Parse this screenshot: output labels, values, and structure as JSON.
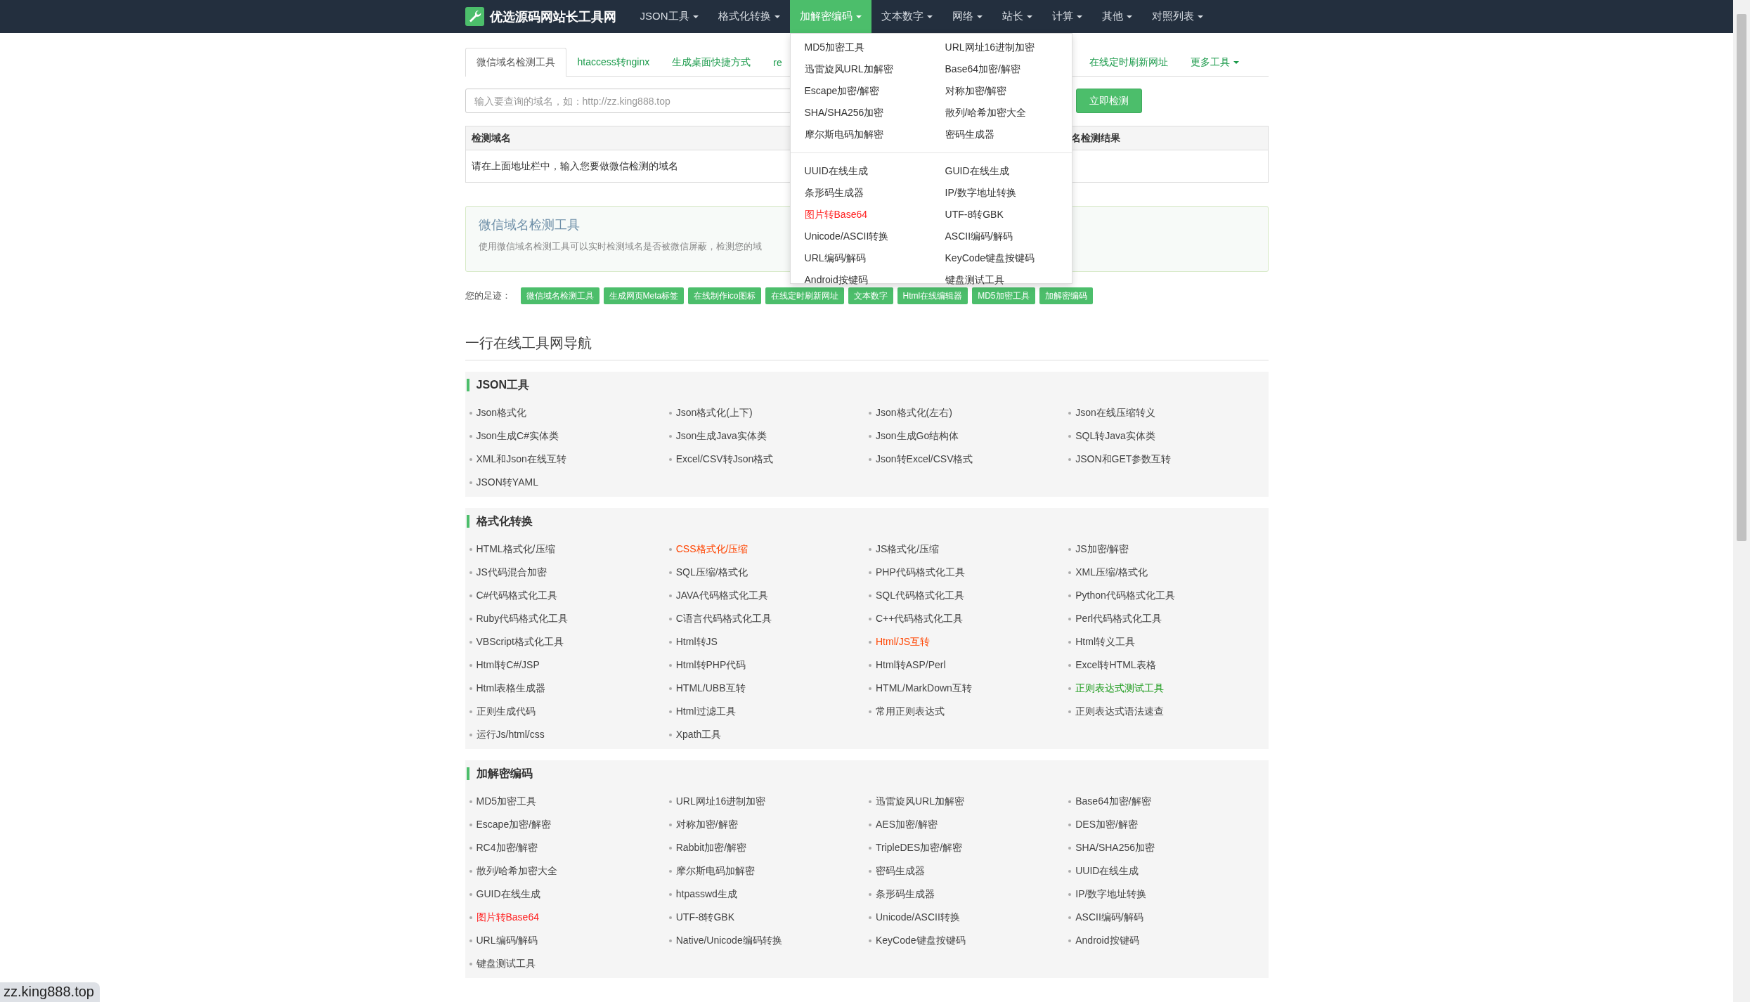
{
  "nav": {
    "brand": "优选源码网站长工具网",
    "items": [
      {
        "label": "JSON工具",
        "selected": false
      },
      {
        "label": "格式化转换",
        "selected": false
      },
      {
        "label": "加解密编码",
        "selected": true
      },
      {
        "label": "文本数字",
        "selected": false
      },
      {
        "label": "网络",
        "selected": false
      },
      {
        "label": "站长",
        "selected": false
      },
      {
        "label": "计算",
        "selected": false
      },
      {
        "label": "其他",
        "selected": false
      },
      {
        "label": "对照列表",
        "selected": false
      }
    ]
  },
  "dropdown": {
    "groups": [
      [
        {
          "label": "MD5加密工具"
        },
        {
          "label": "URL网址16进制加密"
        },
        {
          "label": "迅雷旋风URL加解密"
        },
        {
          "label": "Base64加密/解密"
        },
        {
          "label": "Escape加密/解密"
        },
        {
          "label": "对称加密/解密"
        },
        {
          "label": "SHA/SHA256加密"
        },
        {
          "label": "散列/哈希加密大全"
        },
        {
          "label": "摩尔斯电码加解密"
        },
        {
          "label": "密码生成器"
        }
      ],
      [
        {
          "label": "UUID在线生成"
        },
        {
          "label": "GUID在线生成"
        },
        {
          "label": "条形码生成器"
        },
        {
          "label": "IP/数字地址转换"
        },
        {
          "label": "图片转Base64",
          "color": "#ff2020"
        },
        {
          "label": "UTF-8转GBK"
        },
        {
          "label": "Unicode/ASCII转换"
        },
        {
          "label": "ASCII编码/解码"
        },
        {
          "label": "URL编码/解码"
        },
        {
          "label": "KeyCode键盘按键码"
        },
        {
          "label": "Android按键码"
        },
        {
          "label": "键盘测试工具"
        }
      ]
    ]
  },
  "tabs": [
    {
      "label": "微信域名检测工具",
      "selected": true
    },
    {
      "label": "htaccess转nginx",
      "selected": false
    },
    {
      "label": "生成桌面快捷方式",
      "selected": false
    },
    {
      "label": "re",
      "selected": false
    },
    {
      "label": "在线定时刷新网址",
      "selected": false
    },
    {
      "label": "更多工具",
      "selected": false
    }
  ],
  "search": {
    "placeholder": "输入要查询的域名，如：http://zz.king888.top",
    "button": "立即检测"
  },
  "table": {
    "columns": [
      "检测域名",
      "名检测结果"
    ],
    "rows": [
      [
        "请在上面地址栏中，输入您要做微信检测的域名"
      ]
    ]
  },
  "info": {
    "title": "微信域名检测工具",
    "description": "使用微信域名检测工具可以实时检测域名是否被微信屏蔽，检测您的域"
  },
  "footprints": {
    "label": "您的足迹：",
    "items": [
      "微信域名检测工具",
      "生成网页Meta标签",
      "在线制作ico图标",
      "在线定时刷新网址",
      "文本数字",
      "Html在线编辑器",
      "MD5加密工具",
      "加解密编码"
    ]
  },
  "nav_title": "一行在线工具网导航",
  "sections": [
    {
      "title": "JSON工具",
      "items": [
        {
          "label": "Json格式化"
        },
        {
          "label": "Json格式化(上下)"
        },
        {
          "label": "Json格式化(左右)"
        },
        {
          "label": "Json在线压缩转义"
        },
        {
          "label": "Json生成C#实体类"
        },
        {
          "label": "Json生成Java实体类"
        },
        {
          "label": "Json生成Go结构体"
        },
        {
          "label": "SQL转Java实体类"
        },
        {
          "label": "XML和Json在线互转"
        },
        {
          "label": "Excel/CSV转Json格式"
        },
        {
          "label": "Json转Excel/CSV格式"
        },
        {
          "label": "JSON和GET参数互转"
        },
        {
          "label": "JSON转YAML"
        }
      ]
    },
    {
      "title": "格式化转换",
      "items": [
        {
          "label": "HTML格式化/压缩"
        },
        {
          "label": "CSS格式化/压缩",
          "color": "#ff4400"
        },
        {
          "label": "JS格式化/压缩"
        },
        {
          "label": "JS加密/解密"
        },
        {
          "label": "JS代码混合加密"
        },
        {
          "label": "SQL压缩/格式化"
        },
        {
          "label": "PHP代码格式化工具"
        },
        {
          "label": "XML压缩/格式化"
        },
        {
          "label": "C#代码格式化工具"
        },
        {
          "label": "JAVA代码格式化工具"
        },
        {
          "label": "SQL代码格式化工具"
        },
        {
          "label": "Python代码格式化工具"
        },
        {
          "label": "Ruby代码格式化工具"
        },
        {
          "label": "C语言代码格式化工具"
        },
        {
          "label": "C++代码格式化工具"
        },
        {
          "label": "Perl代码格式化工具"
        },
        {
          "label": "VBScript格式化工具"
        },
        {
          "label": "Html转JS"
        },
        {
          "label": "Html/JS互转",
          "color": "#ff4400"
        },
        {
          "label": "Html转义工具"
        },
        {
          "label": "Html转C#/JSP"
        },
        {
          "label": "Html转PHP代码"
        },
        {
          "label": "Html转ASP/Perl"
        },
        {
          "label": "Excel转HTML表格"
        },
        {
          "label": "Html表格生成器"
        },
        {
          "label": "HTML/UBB互转"
        },
        {
          "label": "HTML/MarkDown互转"
        },
        {
          "label": "正则表达式测试工具",
          "color": "#1a9a1a"
        },
        {
          "label": "正则生成代码"
        },
        {
          "label": "Html过滤工具"
        },
        {
          "label": "常用正则表达式"
        },
        {
          "label": "正则表达式语法速查"
        },
        {
          "label": "运行Js/html/css"
        },
        {
          "label": "Xpath工具"
        }
      ]
    },
    {
      "title": "加解密编码",
      "items": [
        {
          "label": "MD5加密工具"
        },
        {
          "label": "URL网址16进制加密"
        },
        {
          "label": "迅雷旋风URL加解密"
        },
        {
          "label": "Base64加密/解密"
        },
        {
          "label": "Escape加密/解密"
        },
        {
          "label": "对称加密/解密"
        },
        {
          "label": "AES加密/解密"
        },
        {
          "label": "DES加密/解密"
        },
        {
          "label": "RC4加密/解密"
        },
        {
          "label": "Rabbit加密/解密"
        },
        {
          "label": "TripleDES加密/解密"
        },
        {
          "label": "SHA/SHA256加密"
        },
        {
          "label": "散列/哈希加密大全"
        },
        {
          "label": "摩尔斯电码加解密"
        },
        {
          "label": "密码生成器"
        },
        {
          "label": "UUID在线生成"
        },
        {
          "label": "GUID在线生成"
        },
        {
          "label": "htpasswd生成"
        },
        {
          "label": "条形码生成器"
        },
        {
          "label": "IP/数字地址转换"
        },
        {
          "label": "图片转Base64",
          "color": "#ff2020"
        },
        {
          "label": "UTF-8转GBK"
        },
        {
          "label": "Unicode/ASCII转换"
        },
        {
          "label": "ASCII编码/解码"
        },
        {
          "label": "URL编码/解码"
        },
        {
          "label": "Native/Unicode编码转换"
        },
        {
          "label": "KeyCode键盘按键码"
        },
        {
          "label": "Android按键码"
        },
        {
          "label": "键盘测试工具"
        }
      ]
    }
  ],
  "status_url": "zz.king888.top"
}
